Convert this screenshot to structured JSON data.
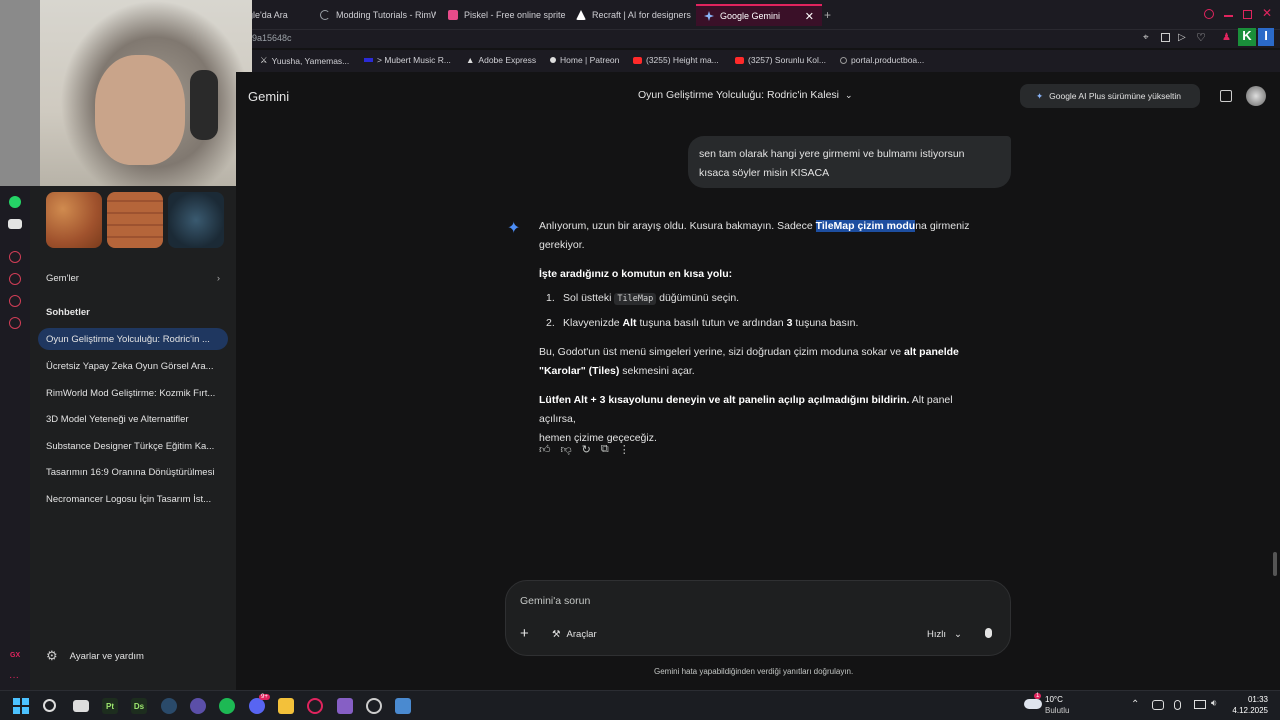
{
  "browser": {
    "tabs": [
      {
        "label": "gle'da Ara",
        "color": "#4285f4"
      },
      {
        "label": "Modding Tutorials - RimW",
        "color": "#9aa0a6"
      },
      {
        "label": "Piskel - Free online sprite",
        "color": "#e84b8a"
      },
      {
        "label": "Recraft | AI for designers",
        "color": "#ffffff"
      },
      {
        "label": "Google Gemini",
        "color": "#8ab4f8",
        "active": true
      }
    ],
    "new_tab_label": "+",
    "url_fragment": "9a15648c",
    "bookmarks": [
      {
        "label": "Yuusha, Yamemas..."
      },
      {
        "label": "> Mubert Music R..."
      },
      {
        "label": "Adobe Express"
      },
      {
        "label": "Home | Patreon"
      },
      {
        "label": "(3255) Height ma..."
      },
      {
        "label": "(3257) Sorunlu Kol..."
      },
      {
        "label": "portal.productboa..."
      }
    ]
  },
  "gemini": {
    "brand": "Gemini",
    "conversation_title": "Oyun Geliştirme Yolculuğu: Rodric'in Kalesi",
    "upgrade_label": "Google AI Plus sürümüne yükseltin",
    "sidebar": {
      "gems_label": "Gem'ler",
      "chats_label": "Sohbetler",
      "chats": [
        {
          "label": "Oyun Geliştirme Yolculuğu: Rodric'in ...",
          "active": true
        },
        {
          "label": "Ücretsiz Yapay Zeka Oyun Görsel Ara..."
        },
        {
          "label": "RimWorld Mod Geliştirme: Kozmik Fırt..."
        },
        {
          "label": "3D Model Yeteneği ve Alternatifler"
        },
        {
          "label": "Substance Designer Türkçe Eğitim Ka..."
        },
        {
          "label": "Tasarımın 16:9 Oranına Dönüştürülmesi"
        },
        {
          "label": "Necromancer Logosu İçin Tasarım İst..."
        }
      ],
      "settings_label": "Ayarlar ve yardım"
    },
    "user_message": {
      "line1": "sen tam olarak hangi yere girmemi ve bulmamı istiyorsun",
      "line2": "kısaca söyler misin KISACA"
    },
    "response": {
      "p1_a": "Anlıyorum, uzun bir arayış oldu. Kusura bakmayın. Sadece ",
      "p1_highlight": "TileMap çizim modu",
      "p1_b": "na girmeniz",
      "p1_c": "gerekiyor.",
      "heading": "İşte aradığınız o komutun en kısa yolu:",
      "step1_num": "1.",
      "step1_a": "Sol üstteki ",
      "step1_code": "TileMap",
      "step1_b": " düğümünü seçin.",
      "step2_num": "2.",
      "step2_a": "Klavyenizde ",
      "step2_b1": "Alt",
      "step2_c": " tuşuna basılı tutun ve ardından ",
      "step2_b2": "3",
      "step2_d": " tuşuna basın.",
      "p3_a": "Bu, Godot'un üst menü simgeleri yerine, sizi doğrudan çizim moduna sokar ve ",
      "p3_b": "alt panelde",
      "p3_c": "\"Karolar\" (Tiles)",
      "p3_d": " sekmesini açar.",
      "p4_b": "Lütfen Alt + 3 kısayolunu deneyin ve alt panelin açılıp açılmadığını bildirin.",
      "p4_a": " Alt panel açılırsa,",
      "p4_c": "hemen çizime geçeceğiz."
    },
    "input": {
      "placeholder": "Gemini'a sorun",
      "plus": "+",
      "tools_label": "Araçlar",
      "mode_label": "Hızlı"
    },
    "disclaimer": "Gemini hata yapabildiğinden verdiği yanıtları doğrulayın."
  },
  "taskbar": {
    "weather_temp": "10°C",
    "weather_desc": "Bulutlu",
    "weather_badge": "1",
    "time": "01:33",
    "date": "4.12.2025",
    "apps": [
      "Pt",
      "Ds"
    ],
    "discord_badge": "9+"
  },
  "opera_label": "GX",
  "colors": {
    "accent": "#e0245e",
    "highlight": "#1d4ea0",
    "active_chat": "#1f3760",
    "gemini_star": "#4c8df6"
  }
}
